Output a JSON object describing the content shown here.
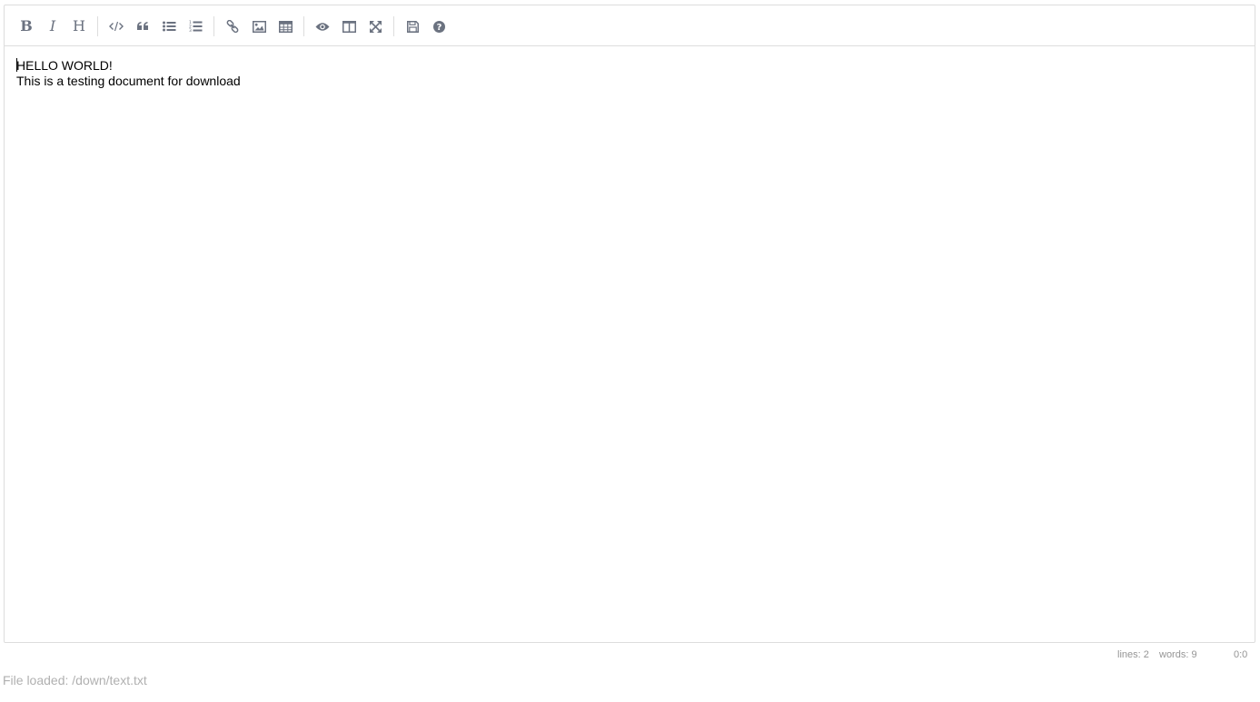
{
  "toolbar": {
    "bold_label": "B",
    "italic_label": "I",
    "heading_label": "H",
    "icons": [
      "bold-icon",
      "italic-icon",
      "heading-icon",
      "code-icon",
      "quote-icon",
      "unordered-list-icon",
      "ordered-list-icon",
      "link-icon",
      "image-icon",
      "table-icon",
      "preview-icon",
      "side-by-side-icon",
      "fullscreen-icon",
      "save-icon",
      "help-icon"
    ],
    "icon_color": "#6b7280"
  },
  "editor": {
    "lines": [
      "HELLO WORLD!",
      "This is a testing document for download"
    ]
  },
  "statusbar": {
    "lines": "lines: 2",
    "words": "words: 9",
    "cursor": "0:0"
  },
  "footer": {
    "file_status": "File loaded: /down/text.txt"
  }
}
